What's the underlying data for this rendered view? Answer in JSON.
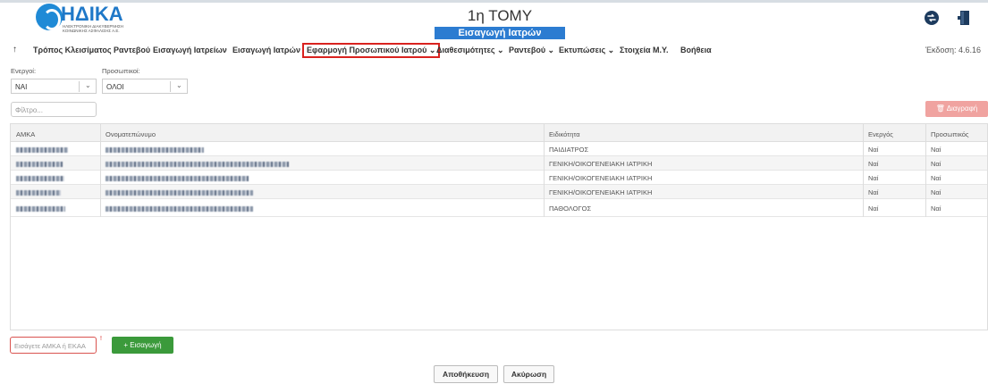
{
  "header": {
    "logo_text": "ΗΔΙΚΑ",
    "logo_subtitle": "ΗΛΕΚΤΡΟΝΙΚΗ ΔΙΑΚΥΒΕΡΝΗΣΗ ΚΟΙΝΩΝΙΚΗΣ ΑΣΦΑΛΙΣΗΣ Α.Ε.",
    "title": "1η ΤΟΜΥ",
    "subtitle": "Εισαγωγή Ιατρών"
  },
  "nav": {
    "items": [
      {
        "label": "Τρόπος Κλεισίματος Ραντεβού"
      },
      {
        "label": "Εισαγωγή Ιατρείων"
      },
      {
        "label": "Εισαγωγή Ιατρών"
      },
      {
        "label": "Εφαρμογή Προσωπικού Ιατρού ⌄"
      },
      {
        "label": "Διαθεσιμότητες ⌄"
      },
      {
        "label": "Ραντεβού ⌄"
      },
      {
        "label": "Εκτυπώσεις ⌄"
      },
      {
        "label": "Στοιχεία Μ.Υ."
      },
      {
        "label": "Βοήθεια"
      }
    ],
    "version": "Έκδοση: 4.6.16"
  },
  "filters": {
    "active_label": "Ενεργοί:",
    "active_value": "ΝΑΙ",
    "personal_label": "Προσωπικοί:",
    "personal_value": "ΟΛΟΙ",
    "search_placeholder": "Φίλτρο..."
  },
  "actions": {
    "delete_label": "🗑 Διαγραφή",
    "amka_placeholder": "Εισάγετε ΑΜΚΑ ή ΕΚΑΑ",
    "required_mark": "!",
    "add_label": "+ Εισαγωγή",
    "save_label": "Αποθήκευση",
    "cancel_label": "Ακύρωση"
  },
  "table": {
    "headers": [
      "ΑΜΚΑ",
      "Ονοματεπώνυμο",
      "Ειδικότητα",
      "Ενεργός",
      "Προσωπικός"
    ],
    "rows": [
      {
        "specialty": "ΠΑΙΔΙΑΤΡΟΣ",
        "active": "Ναί",
        "personal": "Ναί"
      },
      {
        "specialty": "ΓΕΝΙΚΗ/ΟΙΚΟΓΕΝΕΙΑΚΗ ΙΑΤΡΙΚΗ",
        "active": "Ναί",
        "personal": "Ναί"
      },
      {
        "specialty": "ΓΕΝΙΚΗ/ΟΙΚΟΓΕΝΕΙΑΚΗ ΙΑΤΡΙΚΗ",
        "active": "Ναί",
        "personal": "Ναί"
      },
      {
        "specialty": "ΓΕΝΙΚΗ/ΟΙΚΟΓΕΝΕΙΑΚΗ ΙΑΤΡΙΚΗ",
        "active": "Ναί",
        "personal": "Ναί"
      },
      {
        "specialty": "ΠΑΘΟΛΟΓΟΣ",
        "active": "Ναί",
        "personal": "Ναί"
      }
    ]
  },
  "colors": {
    "accent": "#2c7cd1",
    "danger": "#d9221f",
    "success": "#3b9a3b"
  }
}
